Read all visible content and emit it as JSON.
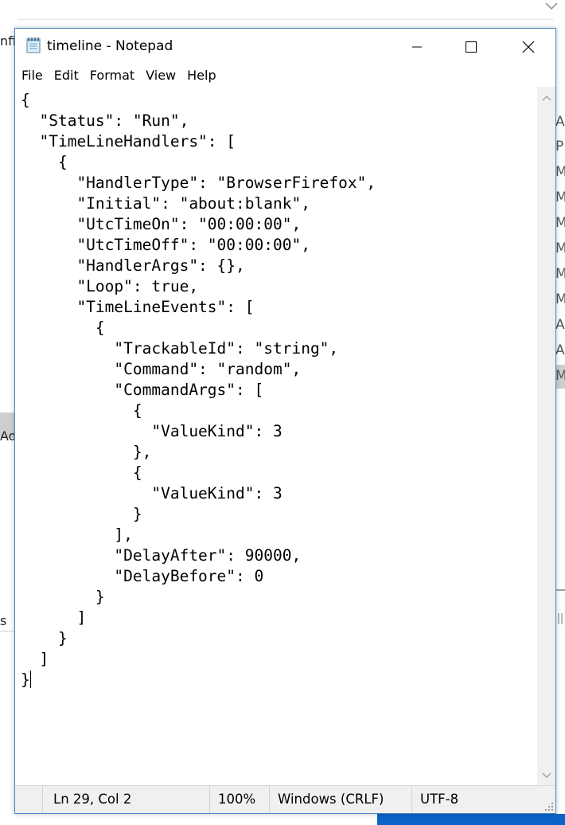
{
  "window": {
    "title": "timeline - Notepad"
  },
  "menu": [
    "File",
    "Edit",
    "Format",
    "View",
    "Help"
  ],
  "editor": {
    "content": "{\n  \"Status\": \"Run\",\n  \"TimeLineHandlers\": [\n    {\n      \"HandlerType\": \"BrowserFirefox\",\n      \"Initial\": \"about:blank\",\n      \"UtcTimeOn\": \"00:00:00\",\n      \"UtcTimeOff\": \"00:00:00\",\n      \"HandlerArgs\": {},\n      \"Loop\": true,\n      \"TimeLineEvents\": [\n        {\n          \"TrackableId\": \"string\",\n          \"Command\": \"random\",\n          \"CommandArgs\": [\n            {\n              \"ValueKind\": 3\n            },\n            {\n              \"ValueKind\": 3\n            }\n          ],\n          \"DelayAfter\": 90000,\n          \"DelayBefore\": 0\n        }\n      ]\n    }\n  ]\n}"
  },
  "status": {
    "position": "Ln 29, Col 2",
    "zoom": "100%",
    "line_ending": "Windows (CRLF)",
    "encoding": "UTF-8"
  },
  "background": {
    "left_fragments": [
      "nfig",
      "Ado",
      "s"
    ],
    "right_fragments": [
      "A",
      "P",
      "M",
      "M",
      "M",
      "M",
      "M",
      "M",
      "A",
      "A",
      "M"
    ]
  },
  "icons": {
    "app": "notepad-icon",
    "minimize": "minimize-icon",
    "maximize": "maximize-icon",
    "close": "close-icon",
    "scroll_up": "chevron-up-icon",
    "scroll_down": "chevron-down-icon",
    "bg_expand": "chevron-down-icon"
  },
  "colors": {
    "window_border": "#4b87c9",
    "taskbar": "#0a64c8",
    "statusbar": "#f0f0f0"
  }
}
